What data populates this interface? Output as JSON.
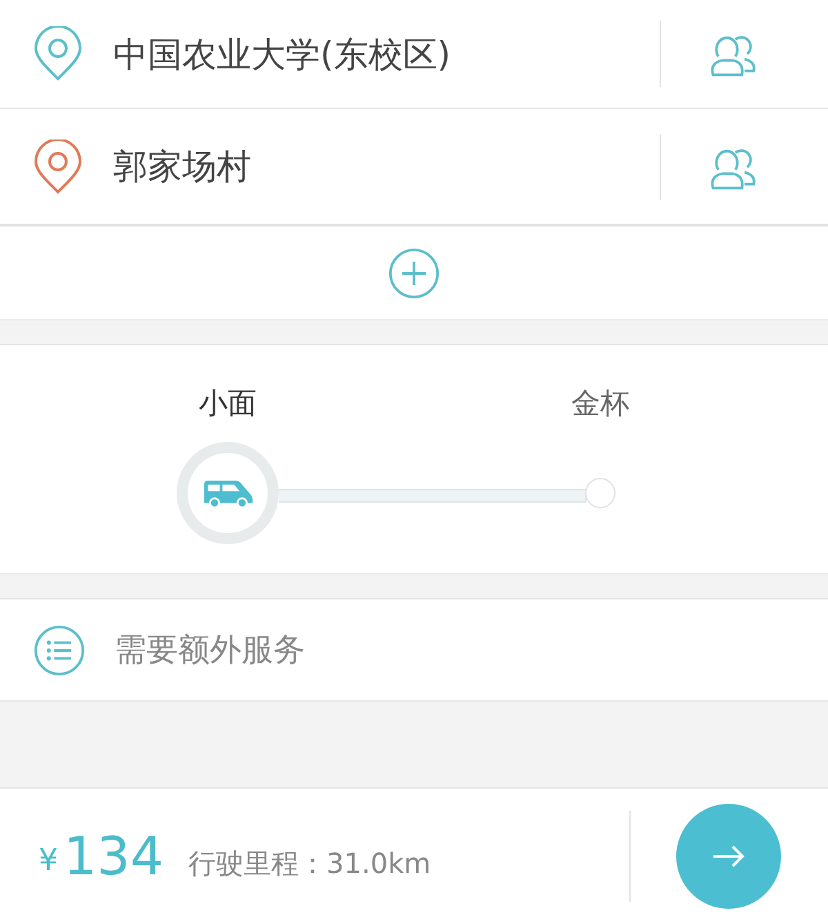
{
  "locations": [
    {
      "kind": "start",
      "name": "中国农业大学(东校区)"
    },
    {
      "kind": "end",
      "name": "郭家场村"
    }
  ],
  "vehicles": [
    {
      "name": "小面",
      "selected": true
    },
    {
      "name": "金杯",
      "selected": false
    }
  ],
  "extra_service": {
    "label": "需要额外服务"
  },
  "footer": {
    "currency": "¥",
    "price": "134",
    "distance": "行驶里程：31.0km"
  }
}
